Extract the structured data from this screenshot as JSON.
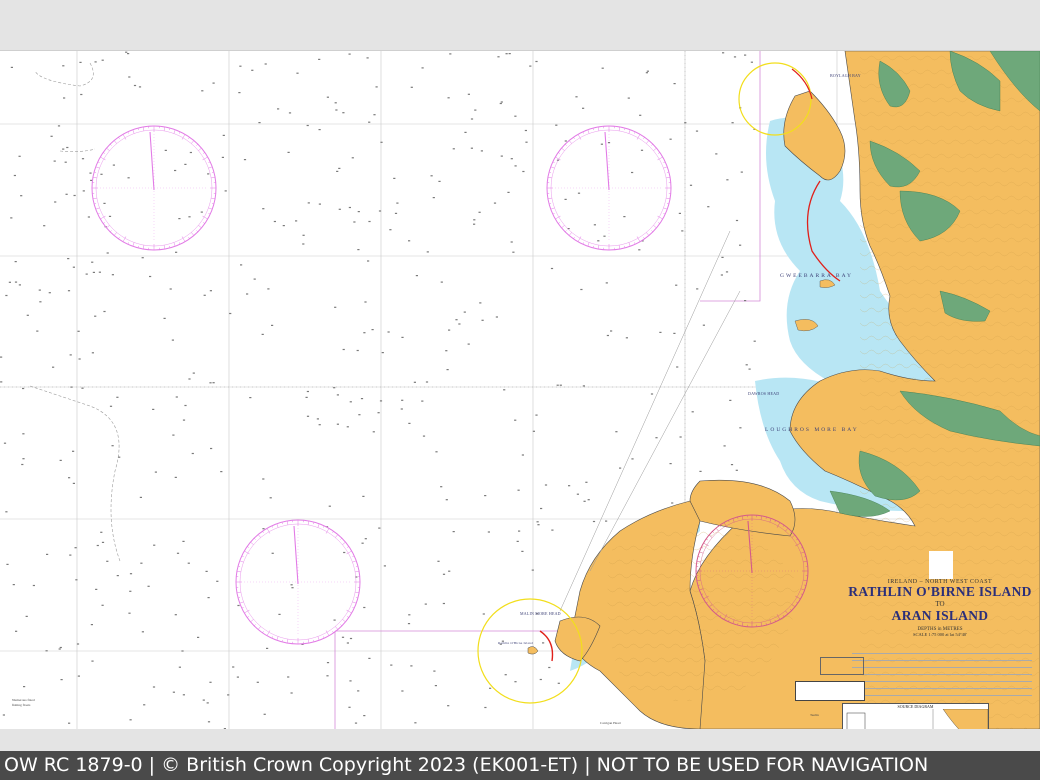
{
  "footer": {
    "text": "OW RC 1879-0 | © British Crown Copyright 2023 (EK001-ET) | NOT TO BE USED FOR NAVIGATION"
  },
  "chart": {
    "subtitle": "IRELAND – NORTH WEST COAST",
    "title_line1": "RATHLIN O'BIRNE ISLAND",
    "title_to": "TO",
    "title_line2": "ARAN ISLAND",
    "depths": "DEPTHS in METRES",
    "scale": "SCALE 1:75 000 at lat 54°40'",
    "source_title": "SOURCE DIAGRAM",
    "colors": {
      "land": "#f4bd5f",
      "drying": "#6ea87a",
      "shallow": "#b8e6f4",
      "sea": "#ffffff",
      "grid": "#c8c8c8",
      "compass": "#e27be6",
      "light_sector_red": "#e0201a",
      "light_sector_yellow": "#f2de1c",
      "title_blue": "#2b2f7a"
    },
    "labels": {
      "donegal_bay_head": "BOYLAGH BAY",
      "gweebarra": "GWEEBARRA BAY",
      "loughros": "LOUGHROS MORE BAY",
      "dawros": "DAWROS HEAD",
      "malin_more": "MALIN MORE HEAD",
      "rathlin": "Rathlin O'Birne Island"
    }
  }
}
